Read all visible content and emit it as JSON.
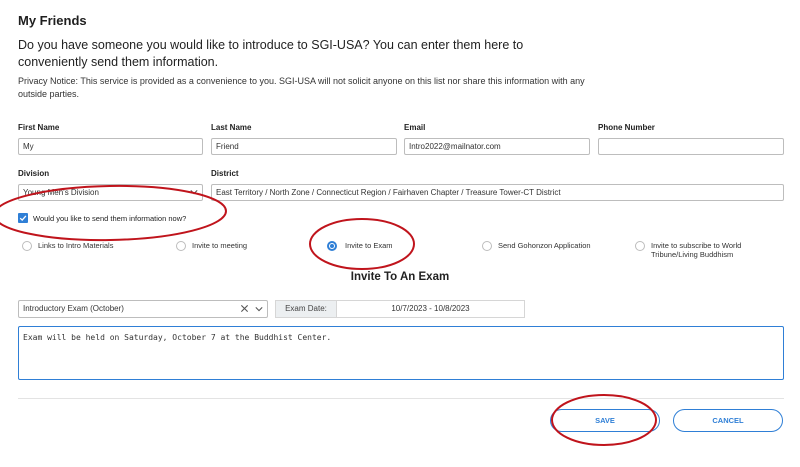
{
  "page": {
    "title": "My Friends",
    "intro": "Do you have someone you would like to introduce to SGI-USA? You can enter them here to conveniently send them information.",
    "privacy": "Privacy Notice: This service is provided as a convenience to you. SGI-USA will not solicit anyone on this list nor share this information with any outside parties."
  },
  "form": {
    "first_name": {
      "label": "First Name",
      "value": "My"
    },
    "last_name": {
      "label": "Last Name",
      "value": "Friend"
    },
    "email": {
      "label": "Email",
      "value": "Intro2022@mailnator.com"
    },
    "phone": {
      "label": "Phone Number",
      "value": ""
    },
    "division": {
      "label": "Division",
      "value": "Young Men's Division"
    },
    "district": {
      "label": "District",
      "value": "East Territory / North Zone / Connecticut Region / Fairhaven Chapter / Treasure Tower-CT District"
    },
    "send_info": {
      "label": "Would you like to send them information now?",
      "checked": true
    }
  },
  "options": [
    {
      "label": "Links to Intro Materials",
      "selected": false
    },
    {
      "label": "Invite to meeting",
      "selected": false
    },
    {
      "label": "Invite to Exam",
      "selected": true
    },
    {
      "label": "Send Gohonzon Application",
      "selected": false
    },
    {
      "label": "Invite to subscribe to World Tribune/Living Buddhism",
      "selected": false
    }
  ],
  "exam": {
    "section_title": "Invite To An Exam",
    "selected_exam": "Introductory Exam (October)",
    "date_label": "Exam Date:",
    "date_value": "10/7/2023 - 10/8/2023",
    "message": "Exam will be held on Saturday, October 7 at the Buddhist Center."
  },
  "actions": {
    "save": "SAVE",
    "cancel": "CANCEL"
  },
  "colors": {
    "accent": "#2f7fd6",
    "annotation": "#c0141c"
  }
}
